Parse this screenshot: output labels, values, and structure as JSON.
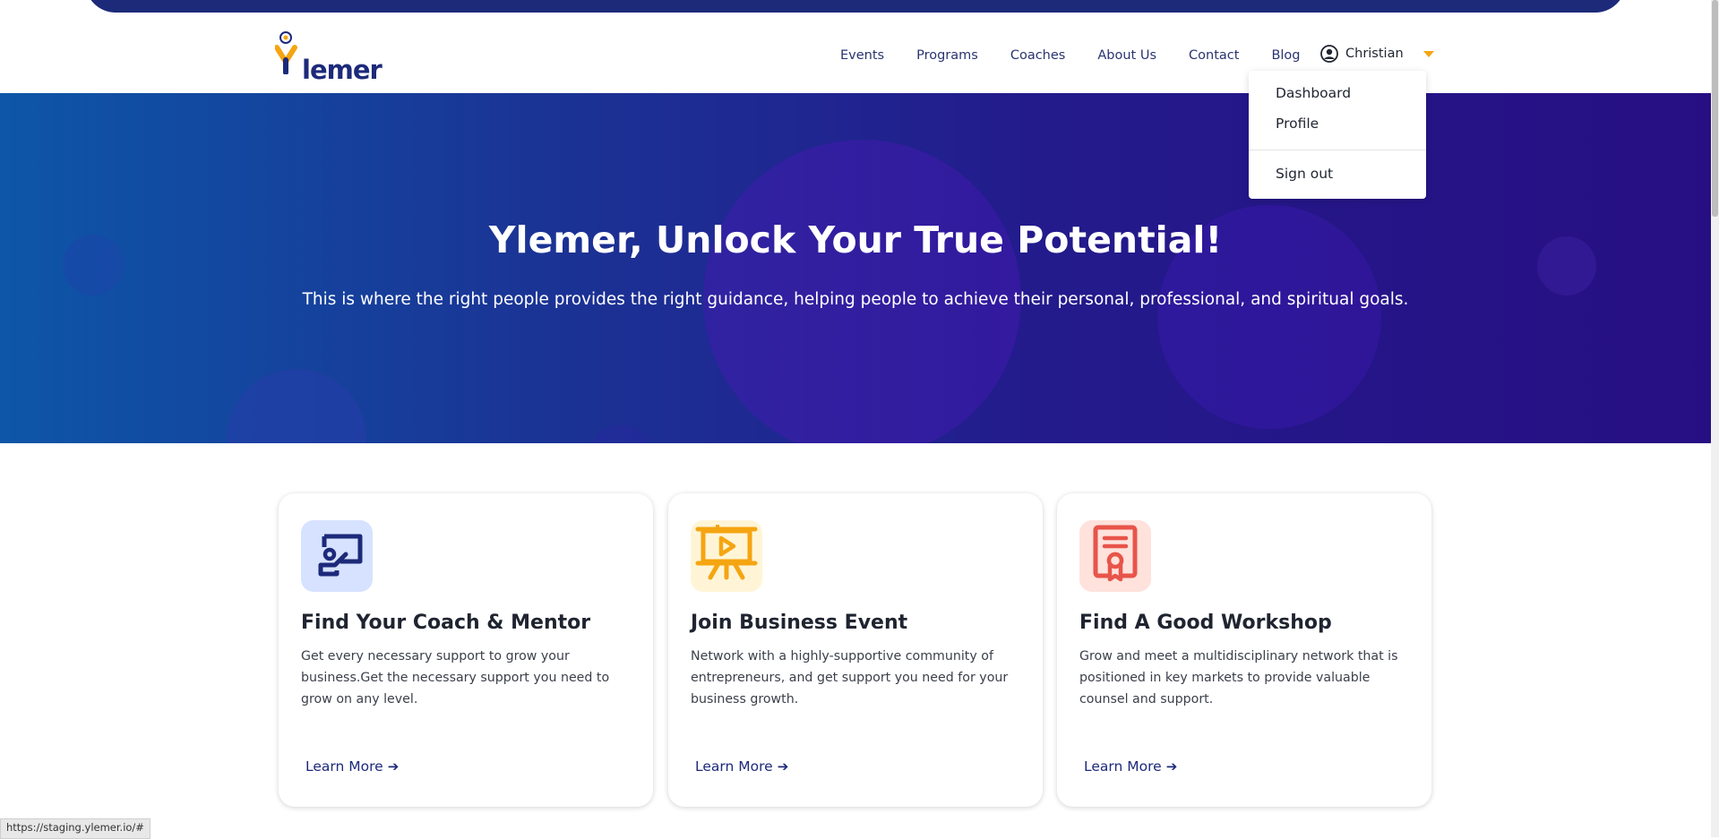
{
  "brand": {
    "name": "Ylemer",
    "navy": "#1d2a7a",
    "accent": "#f5a511"
  },
  "nav": {
    "items": [
      "Events",
      "Programs",
      "Coaches",
      "About Us",
      "Contact",
      "Blog"
    ],
    "user_name": "Christian"
  },
  "user_menu": {
    "items": [
      "Dashboard",
      "Profile"
    ],
    "sign_out": "Sign out"
  },
  "hero": {
    "title": "Ylemer, Unlock Your True Potential!",
    "subtitle": "This is where the right people provides the right guidance, helping people to achieve their personal, professional, and spiritual goals."
  },
  "cards": [
    {
      "icon": "coach-presentation-icon",
      "icon_bg": "#d6e2ff",
      "icon_color": "#1d2a7a",
      "title": "Find Your Coach & Mentor",
      "text": "Get every necessary support to grow your business.Get the necessary support you need to grow on any level.",
      "link": "Learn More"
    },
    {
      "icon": "video-board-icon",
      "icon_bg": "#fff5d6",
      "icon_color": "#f5a511",
      "title": "Join Business Event",
      "text": "Network with a highly-supportive community of entrepreneurs, and get support you need for your business growth.",
      "link": "Learn More"
    },
    {
      "icon": "certificate-icon",
      "icon_bg": "#ffe2dc",
      "icon_color": "#e8544a",
      "title": "Find A Good Workshop",
      "text": "Grow and meet a multidisciplinary network that is positioned in key markets to provide valuable counsel and support.",
      "link": "Learn More"
    }
  ],
  "status_url": "https://staging.ylemer.io/#"
}
